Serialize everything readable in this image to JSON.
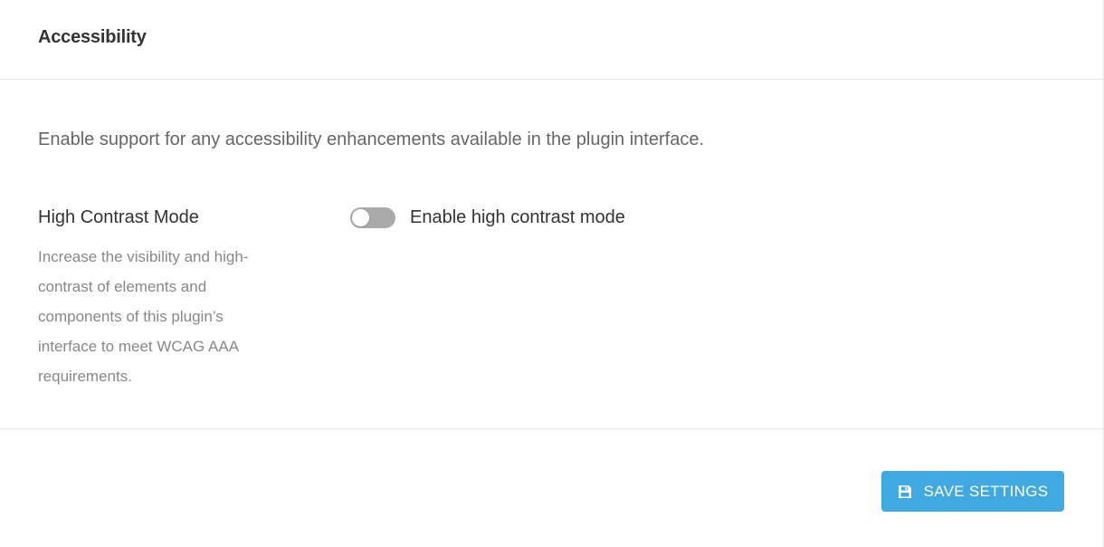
{
  "header": {
    "title": "Accessibility"
  },
  "main": {
    "intro": "Enable support for any accessibility enhancements available in the plugin interface.",
    "settings": [
      {
        "title": "High Contrast Mode",
        "description": "Increase the visibility and high-contrast of elements and components of this plugin’s interface to meet WCAG AAA requirements.",
        "toggle_label": "Enable high contrast mode",
        "enabled": false
      }
    ]
  },
  "footer": {
    "save_label": "SAVE SETTINGS",
    "save_icon": "floppy-disk-icon"
  },
  "colors": {
    "accent": "#40a9e0",
    "toggle_off": "#aaaaaa",
    "divider": "#e6e6e6"
  }
}
